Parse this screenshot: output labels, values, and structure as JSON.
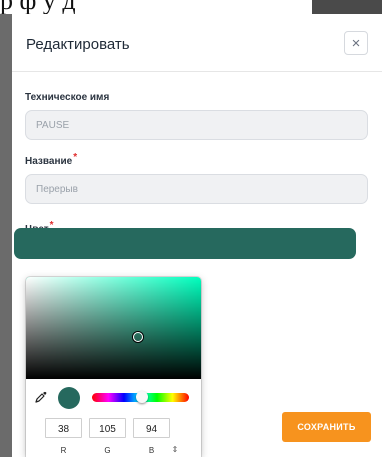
{
  "background": {
    "heading_fragment": "р ф у д"
  },
  "modal": {
    "title": "Редактировать",
    "close_symbol": "×",
    "fields": {
      "technical_name": {
        "label": "Техническое имя",
        "value": "PAUSE"
      },
      "name": {
        "label": "Название",
        "required_mark": "*",
        "placeholder": "Перерыв"
      },
      "color": {
        "label": "Цвет",
        "required_mark": "*",
        "value_hex": "#26695e"
      }
    },
    "save_label": "СОХРАНИТЬ"
  },
  "color_picker": {
    "hue_color": "#00ffbe",
    "saturation_fraction": 0.64,
    "value_fraction": 0.41,
    "hue_fraction": 0.52,
    "icons": {
      "eyedropper": "eyedropper-icon",
      "mode_toggle": "sort-updown-icon"
    },
    "mode_toggle_symbol": "⇕",
    "rgb": {
      "r": {
        "label": "R",
        "value": "38"
      },
      "g": {
        "label": "G",
        "value": "105"
      },
      "b": {
        "label": "B",
        "value": "94"
      }
    }
  },
  "colors": {
    "accent_orange": "#f7931e",
    "selected_color": "#26695e",
    "required": "#e02d2d"
  }
}
